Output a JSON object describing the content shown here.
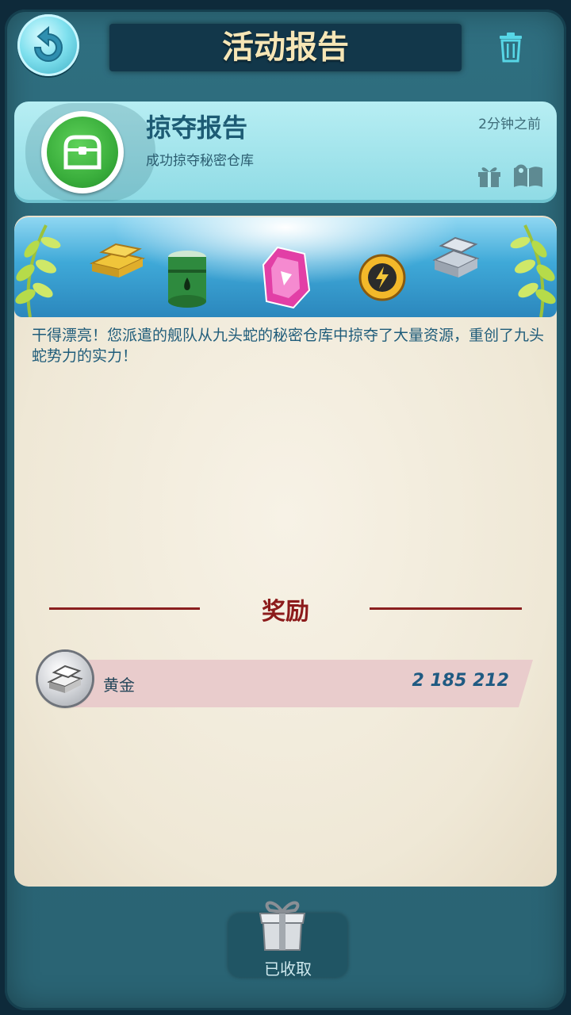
{
  "header": {
    "title": "活动报告"
  },
  "report": {
    "title": "掠夺报告",
    "subtitle": "成功掠夺秘密仓库",
    "time": "2分钟之前",
    "message": "干得漂亮！您派遣的舰队从九头蛇的秘密仓库中掠夺了大量资源，重创了九头蛇势力的实力！"
  },
  "rewards": {
    "title": "奖励",
    "items": [
      {
        "name": "黄金",
        "value": "2 185 212",
        "icon": "gold-bars-icon"
      }
    ]
  },
  "footer": {
    "collect_label": "已收取"
  },
  "icons": [
    "back-arrow-icon",
    "trash-icon",
    "chest-icon",
    "gift-icon",
    "book-icon",
    "gold-bars-icon"
  ],
  "colors": {
    "title_text": "#f6e6b6",
    "report_title": "#1d5b74",
    "reward_title": "#8c1b1b",
    "reward_value": "#1f5a82",
    "panel_bg": "#2f6f80",
    "header_card": "#b7eef3"
  }
}
